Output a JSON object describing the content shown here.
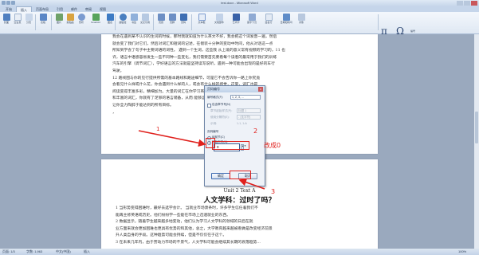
{
  "window": {
    "title": "test.docx - Microsoft Word"
  },
  "tabs": [
    "开始",
    "插入",
    "页面布局",
    "引用",
    "邮件",
    "审阅",
    "视图"
  ],
  "active_tab": 1,
  "ribbon": {
    "buttons": [
      "封面",
      "空白页",
      "分页",
      "表格",
      "图片",
      "剪贴画",
      "形状",
      "SmartArt",
      "图表",
      "超链接",
      "书签",
      "交叉引用",
      "页眉",
      "页脚",
      "页码",
      "文本框",
      "文档部件",
      "艺术字",
      "首字下沉",
      "签名行",
      "日期和时间",
      "对象",
      "公式",
      "符号",
      "编号"
    ],
    "pi_symbol": "π",
    "omega_symbol": "Ω"
  },
  "document": {
    "page1_lines": [
      "我会在遇到某不认识的生词的时候，那时我就知道为什么英文不好，我会把这个词发音一遍，然后",
      "就会变了我们对它们，然后对词汇和短词的记述，在假装十分钟的变动中时间，他从对话这一点",
      "所知到学会了句子中主要词语的词性。  遇到一个生词，这些我 从上境的意义常有视频的学习的，11 也",
      "许，语言中语感容易发生一些不同种一些变化，我们需要首先要看每个读者的最常用于我们的训练",
      "汽车的引擎（调节词汇），学好语言的方法就是坚持读写说听，遇到一种可能会出现的是好的车行",
      "驾驶。",
      "    12 路线图与你的见行提供所需的基本路线和路途细节，可是它不会告诉你一路上你究竟",
      "会看见什么样或什么花，你会遇到什么样的人，或会有什么样的感觉，这里，词汇也是",
      "阅读变得丰富多彩，精细加为。大量的词汇在你学习英语中对英语、在语法中的需要",
      "和丰富的词汇，你就有了足够的语言储备，从而  能够运用一些 常见的语言...",
      "让你全力陶醉于能达到的所有目标。",
      "      ，"
    ],
    "page2_unit": "Unit 2 Text A",
    "page2_heading": "人文学科：过时了吗？",
    "page2_lines": [
      "    1 当形势变得困难时，最好去选学会计。 当就业市场萧条时，许多学生信任着我们不",
      "能再主修英语或历史。他们纷纷学一些能在市场上迅速就业的东西。",
      "    2 数据显示，随着学生越来越多地变动，他们认为学习人文学科的领域的日后在就",
      "业方面来就会更加困难也更具有优势的和其他，总之，大学教育越来越被看做是改变经济前景",
      "升人类自身的手段。这种趋势可能会持续，但是不仅仅在于这个。",
      "    3 在未来几年内，由于劳动力市场的不景气，人文学科可能会继续其长期的衰落趋势..."
    ]
  },
  "dialog": {
    "title": "页码编号",
    "close_label": "x",
    "format_label": "编号格式(F):",
    "format_value": "1, 2, 3, ...",
    "include_chapter_label": "包含章节号(N)",
    "chapter_style_label": "章节起始样式(P):",
    "chapter_style_value": "标题 1",
    "separator_label": "使用分隔符(E):",
    "separator_value": "- (连字符)",
    "example_label": "示例:",
    "example_value": "1-1, 1-A",
    "numbering_label": "页码编号",
    "continue_label": "续前节(C)",
    "start_at_label": "起始页码(A):",
    "start_at_value": "0",
    "ok_label": "确定",
    "cancel_label": "取消"
  },
  "annotations": {
    "num1": "1",
    "num2": "2",
    "num3": "3",
    "change_note": "改成0",
    "color": "#e0201c"
  },
  "status": {
    "page": "页面: 1/3",
    "words": "字数: 1,963",
    "language": "中文(中国)",
    "mode": "插入",
    "zoom": "100%"
  }
}
